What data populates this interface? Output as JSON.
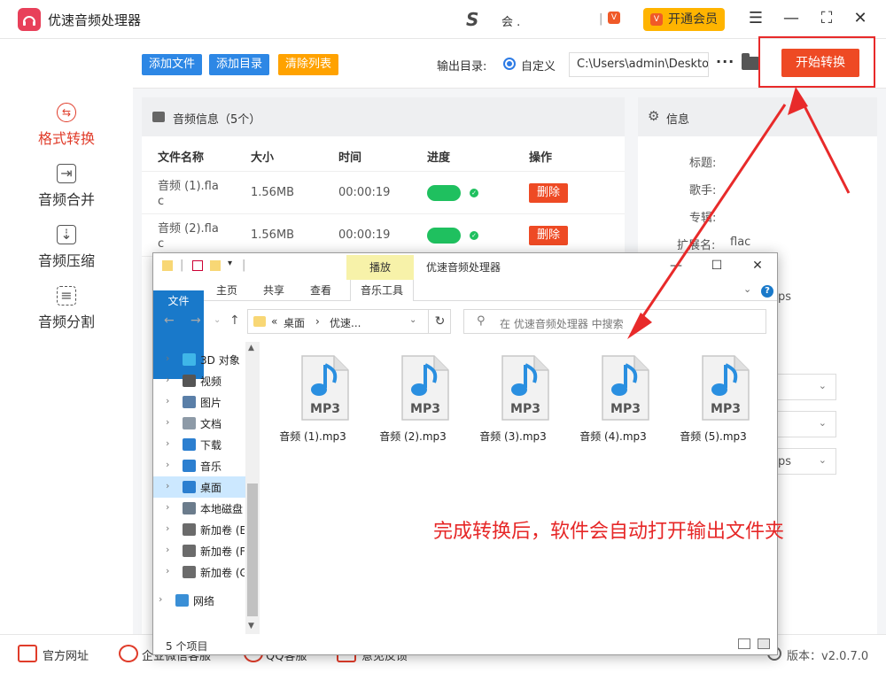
{
  "app": {
    "title": "优速音频处理器",
    "user_name": "会 .",
    "user_sep": "|",
    "vip_label": "开通会员",
    "vip_icon": "vip-icon"
  },
  "window_controls": [
    "menu-icon",
    "minimize-icon",
    "maximize-icon",
    "close-icon"
  ],
  "sidebar": {
    "items": [
      {
        "label": "格式转换",
        "icon": "format-convert-icon",
        "active": true
      },
      {
        "label": "音频合并",
        "icon": "audio-merge-icon",
        "active": false
      },
      {
        "label": "音频压缩",
        "icon": "audio-compress-icon",
        "active": false
      },
      {
        "label": "音频分割",
        "icon": "audio-split-icon",
        "active": false
      }
    ]
  },
  "toolbar": {
    "add_file": "添加文件",
    "add_dir": "添加目录",
    "clear_list": "清除列表",
    "output_label": "输出目录:",
    "radio_custom": "自定义",
    "output_path": "C:\\Users\\admin\\Deskto",
    "more": "···",
    "start": "开始转换",
    "colors": {
      "add": "#2d87e5",
      "clear": "#ffa200",
      "start": "#ee4a24"
    }
  },
  "audio_panel": {
    "title": "音频信息（5个）",
    "columns": [
      "文件名称",
      "大小",
      "时间",
      "进度",
      "操作"
    ],
    "rows": [
      {
        "name_line1": "音频 (1).fla",
        "name_line2": "c",
        "size": "1.56MB",
        "time": "00:00:19",
        "progress": 1.0,
        "action": "删除"
      },
      {
        "name_line1": "音频 (2).fla",
        "name_line2": "c",
        "size": "1.56MB",
        "time": "00:00:19",
        "progress": 1.0,
        "action": "删除"
      }
    ]
  },
  "info_panel": {
    "title": "信息",
    "fields": [
      {
        "label": "标题:",
        "value": ""
      },
      {
        "label": "歌手:",
        "value": ""
      },
      {
        "label": "专辑:",
        "value": ""
      },
      {
        "label": "扩展名:",
        "value": "flac"
      }
    ],
    "partial_text": "ps",
    "partial_select": "ps"
  },
  "bottom_bar": {
    "items": [
      "官方网址",
      "企业微信客服",
      "QQ客服",
      "意见反馈"
    ],
    "version": "版本：v2.0.7.0"
  },
  "explorer": {
    "context_tab": "播放",
    "window_title": "优速音频处理器",
    "tabs": [
      "文件",
      "主页",
      "共享",
      "查看",
      "音乐工具"
    ],
    "address": {
      "prefix": "«",
      "part1": "桌面",
      "sep": "›",
      "part2": "优速..."
    },
    "search_placeholder": "在 优速音频处理器 中搜索",
    "nav_items": [
      {
        "label": "3D 对象",
        "icon": "3d-objects-icon",
        "color": "#3fb6e8"
      },
      {
        "label": "视频",
        "icon": "video-icon",
        "color": "#555555"
      },
      {
        "label": "图片",
        "icon": "pictures-icon",
        "color": "#5a7fa8"
      },
      {
        "label": "文档",
        "icon": "documents-icon",
        "color": "#8d9aa7"
      },
      {
        "label": "下载",
        "icon": "download-icon",
        "color": "#2c7fd0"
      },
      {
        "label": "音乐",
        "icon": "music-icon",
        "color": "#2c7fd0"
      },
      {
        "label": "桌面",
        "icon": "desktop-icon",
        "color": "#2c7fd0",
        "selected": true
      },
      {
        "label": "本地磁盘",
        "icon": "local-disk-icon",
        "color": "#6b7c8c"
      },
      {
        "label": "新加卷 (E",
        "icon": "drive-icon",
        "color": "#6b6b6b"
      },
      {
        "label": "新加卷 (F",
        "icon": "drive-icon",
        "color": "#6b6b6b"
      },
      {
        "label": "新加卷 (G",
        "icon": "drive-icon",
        "color": "#6b6b6b"
      },
      {
        "label": "网络",
        "icon": "network-icon",
        "color": "#3a8fd6"
      }
    ],
    "files": [
      {
        "name": "音频 (1).mp3",
        "type": "MP3"
      },
      {
        "name": "音频 (2).mp3",
        "type": "MP3"
      },
      {
        "name": "音频 (3).mp3",
        "type": "MP3"
      },
      {
        "name": "音频 (4).mp3",
        "type": "MP3"
      },
      {
        "name": "音频 (5).mp3",
        "type": "MP3"
      }
    ],
    "annotation": "完成转换后，软件会自动打开输出文件夹",
    "status_count": "5 个项目"
  }
}
